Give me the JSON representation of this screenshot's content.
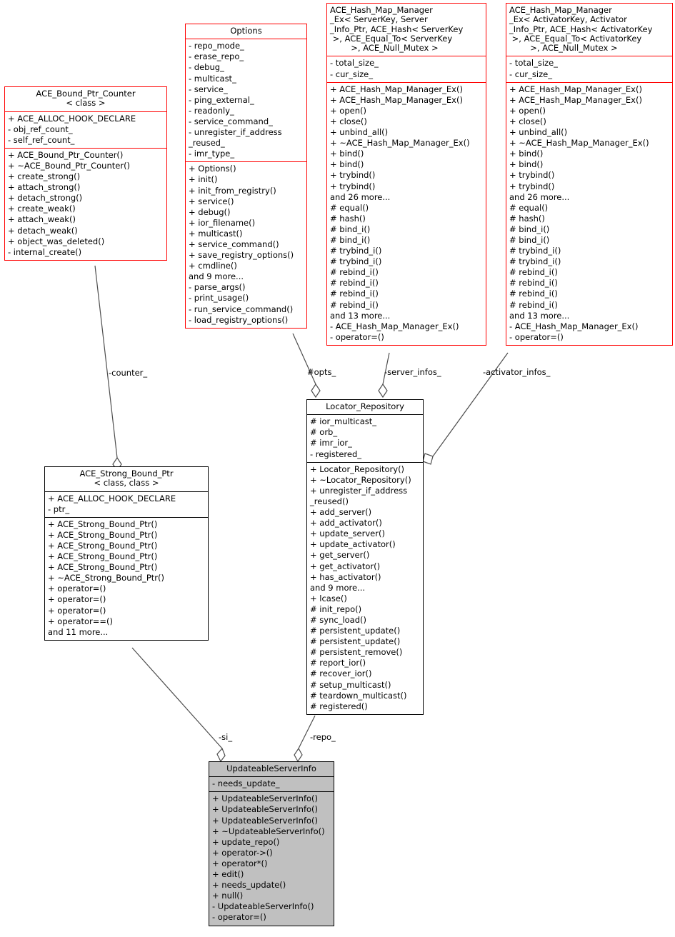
{
  "diagram": {
    "title": "UML class collaboration diagram",
    "colors": {
      "template_border": "#ff0000",
      "plain_border": "#000000",
      "focus_fill": "#c0c0c0",
      "edge": "#4d4d4d"
    }
  },
  "nodes": {
    "bound_ptr_counter": {
      "title": "ACE_Bound_Ptr_Counter\n< class >",
      "attributes": [
        "+ ACE_ALLOC_HOOK_DECLARE",
        "- obj_ref_count_",
        "- self_ref_count_"
      ],
      "methods": [
        "+ ACE_Bound_Ptr_Counter()",
        "+ ~ACE_Bound_Ptr_Counter()",
        "+ create_strong()",
        "+ attach_strong()",
        "+ detach_strong()",
        "+ create_weak()",
        "+ attach_weak()",
        "+ detach_weak()",
        "+ object_was_deleted()",
        "- internal_create()"
      ]
    },
    "options": {
      "title": "Options",
      "attributes": [
        "- repo_mode_",
        "- erase_repo_",
        "- debug_",
        "- multicast_",
        "- service_",
        "- ping_external_",
        "- readonly_",
        "- service_command_",
        "- unregister_if_address",
        "_reused_",
        "- imr_type_"
      ],
      "methods": [
        "+ Options()",
        "+ init()",
        "+ init_from_registry()",
        "+ service()",
        "+ debug()",
        "+ ior_filename()",
        "+ multicast()",
        "+ service_command()",
        "+ save_registry_options()",
        "+ cmdline()",
        "and 9 more...",
        "- parse_args()",
        "- print_usage()",
        "- run_service_command()",
        "- load_registry_options()"
      ]
    },
    "server_map": {
      "title": "ACE_Hash_Map_Manager\n_Ex< ServerKey, Server\n_Info_Ptr, ACE_Hash< ServerKey\n >, ACE_Equal_To< ServerKey\n        >, ACE_Null_Mutex >",
      "attributes": [
        "- total_size_",
        "- cur_size_"
      ],
      "methods": [
        "+ ACE_Hash_Map_Manager_Ex()",
        "+ ACE_Hash_Map_Manager_Ex()",
        "+ open()",
        "+ close()",
        "+ unbind_all()",
        "+ ~ACE_Hash_Map_Manager_Ex()",
        "+ bind()",
        "+ bind()",
        "+ trybind()",
        "+ trybind()",
        "and 26 more...",
        "# equal()",
        "# hash()",
        "# bind_i()",
        "# bind_i()",
        "# trybind_i()",
        "# trybind_i()",
        "# rebind_i()",
        "# rebind_i()",
        "# rebind_i()",
        "# rebind_i()",
        "and 13 more...",
        "- ACE_Hash_Map_Manager_Ex()",
        "- operator=()"
      ]
    },
    "activator_map": {
      "title": "ACE_Hash_Map_Manager\n_Ex< ActivatorKey, Activator\n_Info_Ptr, ACE_Hash< ActivatorKey\n >, ACE_Equal_To< ActivatorKey\n        >, ACE_Null_Mutex >",
      "attributes": [
        "- total_size_",
        "- cur_size_"
      ],
      "methods": [
        "+ ACE_Hash_Map_Manager_Ex()",
        "+ ACE_Hash_Map_Manager_Ex()",
        "+ open()",
        "+ close()",
        "+ unbind_all()",
        "+ ~ACE_Hash_Map_Manager_Ex()",
        "+ bind()",
        "+ bind()",
        "+ trybind()",
        "+ trybind()",
        "and 26 more...",
        "# equal()",
        "# hash()",
        "# bind_i()",
        "# bind_i()",
        "# trybind_i()",
        "# trybind_i()",
        "# rebind_i()",
        "# rebind_i()",
        "# rebind_i()",
        "# rebind_i()",
        "and 13 more...",
        "- ACE_Hash_Map_Manager_Ex()",
        "- operator=()"
      ]
    },
    "locator_repository": {
      "title": "Locator_Repository",
      "attributes": [
        "# ior_multicast_",
        "# orb_",
        "# imr_ior_",
        "- registered_"
      ],
      "methods": [
        "+ Locator_Repository()",
        "+ ~Locator_Repository()",
        "+ unregister_if_address",
        "_reused()",
        "+ add_server()",
        "+ add_activator()",
        "+ update_server()",
        "+ update_activator()",
        "+ get_server()",
        "+ get_activator()",
        "+ has_activator()",
        "and 9 more...",
        "+ lcase()",
        "# init_repo()",
        "# sync_load()",
        "# persistent_update()",
        "# persistent_update()",
        "# persistent_remove()",
        "# report_ior()",
        "# recover_ior()",
        "# setup_multicast()",
        "# teardown_multicast()",
        "# registered()"
      ]
    },
    "strong_bound_ptr": {
      "title": "ACE_Strong_Bound_Ptr\n< class, class >",
      "attributes": [
        "+ ACE_ALLOC_HOOK_DECLARE",
        "- ptr_"
      ],
      "methods": [
        "+ ACE_Strong_Bound_Ptr()",
        "+ ACE_Strong_Bound_Ptr()",
        "+ ACE_Strong_Bound_Ptr()",
        "+ ACE_Strong_Bound_Ptr()",
        "+ ACE_Strong_Bound_Ptr()",
        "+ ~ACE_Strong_Bound_Ptr()",
        "+ operator=()",
        "+ operator=()",
        "+ operator=()",
        "+ operator==()",
        "and 11 more..."
      ]
    },
    "updateable_server_info": {
      "title": "UpdateableServerInfo",
      "attributes": [
        "- needs_update_"
      ],
      "methods": [
        "+ UpdateableServerInfo()",
        "+ UpdateableServerInfo()",
        "+ UpdateableServerInfo()",
        "+ ~UpdateableServerInfo()",
        "+ update_repo()",
        "+ operator->()",
        "+ operator*()",
        "+ edit()",
        "+ needs_update()",
        "+ null()",
        "- UpdateableServerInfo()",
        "- operator=()"
      ]
    }
  },
  "edges": [
    {
      "id": "counter",
      "label": "-counter_",
      "from": "bound_ptr_counter",
      "to": "strong_bound_ptr"
    },
    {
      "id": "opts",
      "label": "#opts_",
      "from": "options",
      "to": "locator_repository"
    },
    {
      "id": "server_infos",
      "label": "-server_infos_",
      "from": "server_map",
      "to": "locator_repository"
    },
    {
      "id": "activator_infos",
      "label": "-activator_infos_",
      "from": "activator_map",
      "to": "locator_repository"
    },
    {
      "id": "si",
      "label": "-si_",
      "from": "strong_bound_ptr",
      "to": "updateable_server_info"
    },
    {
      "id": "repo",
      "label": "-repo_",
      "from": "locator_repository",
      "to": "updateable_server_info"
    }
  ]
}
